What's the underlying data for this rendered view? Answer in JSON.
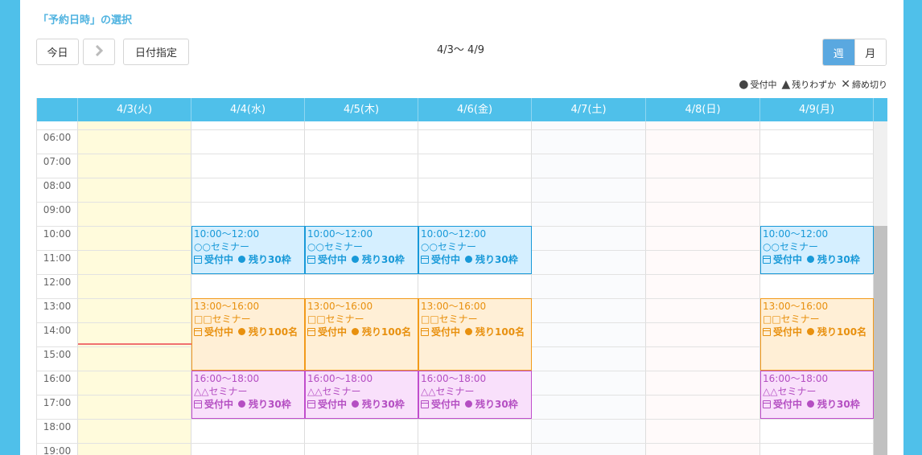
{
  "section_title": "「予約日時」の選択",
  "toolbar": {
    "today_label": "今日",
    "next_label": "›",
    "date_pick_label": "日付指定",
    "range_label": "4/3〜 4/9",
    "view_week": "週",
    "view_month": "月"
  },
  "legend": {
    "open": "受付中",
    "few": "残りわずか",
    "closed": "締め切り"
  },
  "days": [
    "4/3(火)",
    "4/4(水)",
    "4/5(木)",
    "4/6(金)",
    "4/7(土)",
    "4/8(日)",
    "4/9(月)"
  ],
  "times": [
    "06:00",
    "07:00",
    "08:00",
    "09:00",
    "10:00",
    "11:00",
    "12:00",
    "13:00",
    "14:00",
    "15:00",
    "16:00",
    "17:00",
    "18:00",
    "19:00"
  ],
  "events": {
    "blue": {
      "time": "10:00〜12:00",
      "name": "○○セミナー",
      "status": "受付中",
      "remain": "残り30枠"
    },
    "orange": {
      "time": "13:00〜16:00",
      "name": "□□セミナー",
      "status": "受付中",
      "remain": "残り100名"
    },
    "pink": {
      "time": "16:00〜18:00",
      "name": "△△セミナー",
      "status": "受付中",
      "remain": "残り30枠"
    }
  },
  "colors": {
    "header": "#4fc0ea",
    "today_bg": "#fffbdc",
    "saturday_bg": "#fafbfd",
    "sunday_bg": "#fffafa",
    "event_blue": "#1899d8",
    "event_orange": "#f29a1a",
    "event_pink": "#c04ecc"
  }
}
